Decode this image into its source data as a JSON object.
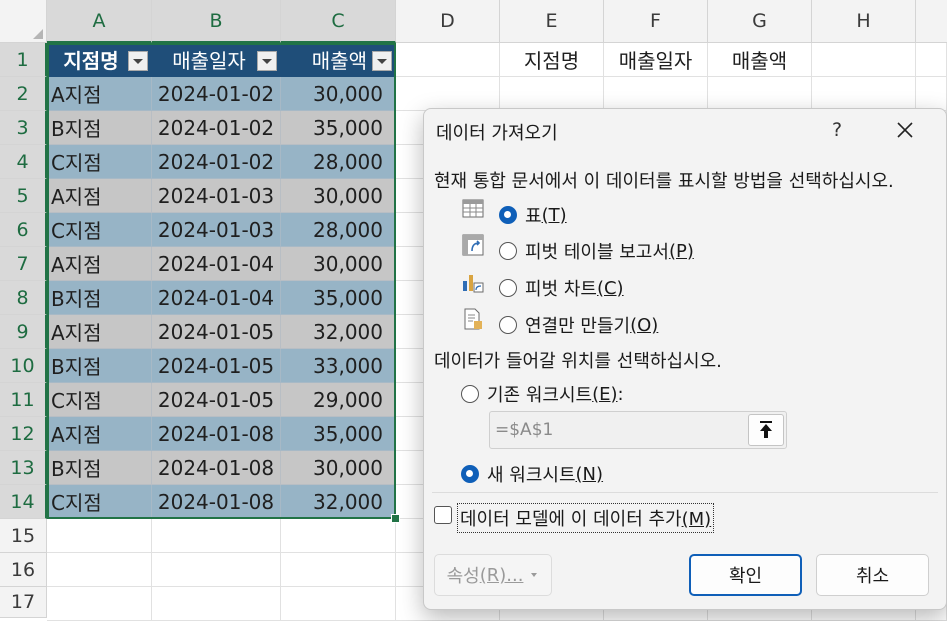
{
  "sheet": {
    "columns": [
      "A",
      "B",
      "C",
      "D",
      "E",
      "F",
      "G",
      "H"
    ],
    "rows": [
      "1",
      "2",
      "3",
      "4",
      "5",
      "6",
      "7",
      "8",
      "9",
      "10",
      "11",
      "12",
      "13",
      "14",
      "15",
      "16",
      "17"
    ],
    "table_headers": [
      "지점명",
      "매출일자",
      "매출액"
    ],
    "table_rows": [
      [
        "A지점",
        "2024-01-02",
        "30,000"
      ],
      [
        "B지점",
        "2024-01-02",
        "35,000"
      ],
      [
        "C지점",
        "2024-01-02",
        "28,000"
      ],
      [
        "A지점",
        "2024-01-03",
        "30,000"
      ],
      [
        "C지점",
        "2024-01-03",
        "28,000"
      ],
      [
        "A지점",
        "2024-01-04",
        "30,000"
      ],
      [
        "B지점",
        "2024-01-04",
        "35,000"
      ],
      [
        "A지점",
        "2024-01-05",
        "32,000"
      ],
      [
        "B지점",
        "2024-01-05",
        "33,000"
      ],
      [
        "C지점",
        "2024-01-05",
        "29,000"
      ],
      [
        "A지점",
        "2024-01-08",
        "35,000"
      ],
      [
        "B지점",
        "2024-01-08",
        "30,000"
      ],
      [
        "C지점",
        "2024-01-08",
        "32,000"
      ]
    ],
    "side_headers": [
      "지점명",
      "매출일자",
      "매출액"
    ],
    "colors": {
      "table_header": "#1f4e79",
      "band_blue": "#97b4c6",
      "band_gray": "#c6c6c6",
      "selection": "#217346"
    }
  },
  "dialog": {
    "title": "데이터 가져오기",
    "help": "?",
    "prompt_display": "현재 통합 문서에서 이 데이터를 표시할 방법을 선택하십시오.",
    "display_options": [
      {
        "label": "표",
        "key": "(T)",
        "icon": "table-icon",
        "selected": true
      },
      {
        "label": "피벗 테이블 보고서",
        "key": "(P)",
        "icon": "pivot-table-icon",
        "selected": false
      },
      {
        "label": "피벗 차트",
        "key": "(C)",
        "icon": "pivot-chart-icon",
        "selected": false
      },
      {
        "label": "연결만 만들기",
        "key": "(O)",
        "icon": "connection-only-icon",
        "selected": false
      }
    ],
    "prompt_location": "데이터가 들어갈 위치를 선택하십시오.",
    "location_options": [
      {
        "label": "기존 워크시트",
        "key": "(E)",
        "suffix": ":",
        "selected": false
      },
      {
        "label": "새 워크시트",
        "key": "(N)",
        "selected": true
      }
    ],
    "reference_value": "=$A$1",
    "data_model_label": "데이터 모델에 이 데이터 추가",
    "data_model_key": "(M)",
    "data_model_checked": false,
    "properties_label": "속성",
    "properties_key": "(R)...",
    "ok_label": "확인",
    "cancel_label": "취소",
    "accent": "#0f5fb8"
  }
}
